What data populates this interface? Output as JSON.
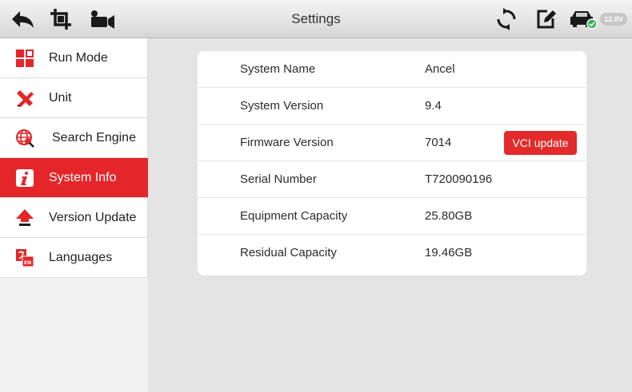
{
  "header": {
    "title": "Settings",
    "voltage": "12.0V",
    "icons": [
      "back-arrow-icon",
      "screenshot-crop-icon",
      "video-record-icon",
      "refresh-icon",
      "edit-note-icon",
      "vehicle-connected-icon"
    ]
  },
  "sidebar": {
    "active_index": 3,
    "items": [
      {
        "label": "Run Mode",
        "icon": "run-mode-icon"
      },
      {
        "label": "Unit",
        "icon": "unit-ruler-pencil-icon"
      },
      {
        "label": "Search Engine",
        "icon": "search-globe-icon"
      },
      {
        "label": "System Info",
        "icon": "info-icon"
      },
      {
        "label": "Version Update",
        "icon": "upload-arrow-icon"
      },
      {
        "label": "Languages",
        "icon": "language-translate-icon"
      }
    ]
  },
  "system_info": {
    "rows": [
      {
        "label": "System Name",
        "value": "Ancel"
      },
      {
        "label": "System Version",
        "value": "9.4"
      },
      {
        "label": "Firmware Version",
        "value": "7014"
      },
      {
        "label": "Serial Number",
        "value": "T720090196"
      },
      {
        "label": "Equipment Capacity",
        "value": "25.80GB"
      },
      {
        "label": "Residual Capacity",
        "value": "19.46GB"
      }
    ],
    "vci_button_label": "VCI update"
  },
  "colors": {
    "accent": "#e4262a",
    "background": "#e4e4e4",
    "card": "#ffffff",
    "check": "#2fb45a"
  }
}
